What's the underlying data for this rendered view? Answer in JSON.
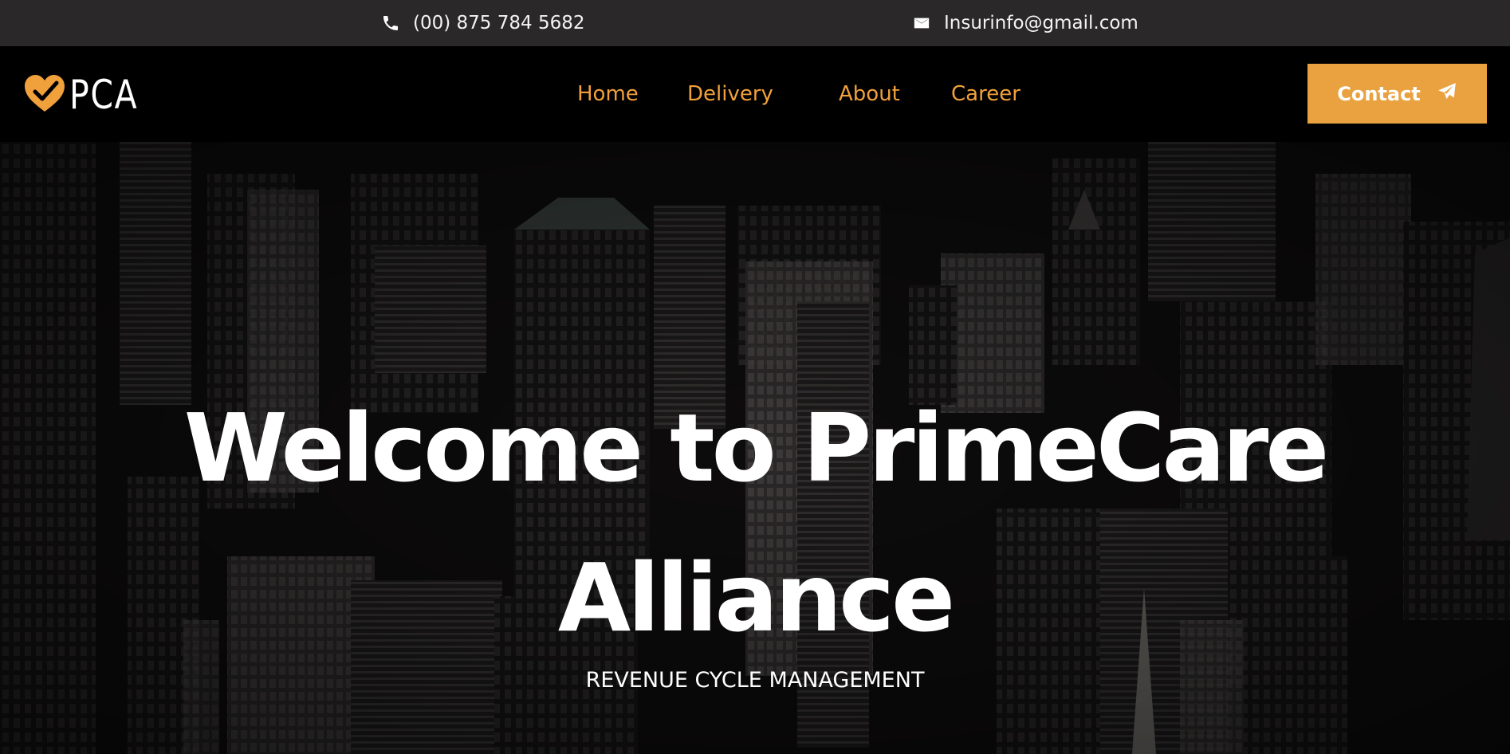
{
  "topbar": {
    "phone": "(00) 875 784 5682",
    "email": "Insurinfo@gmail.com",
    "phone_icon": "phone-icon",
    "email_icon": "mail-icon"
  },
  "navbar": {
    "logo_text": "PCA",
    "logo_icon": "heart-check-icon",
    "links": [
      {
        "label": "Home"
      },
      {
        "label": "Delivery"
      },
      {
        "label": "About"
      },
      {
        "label": "Career"
      }
    ],
    "contact_button": {
      "label": "Contact",
      "icon": "send-icon"
    }
  },
  "hero": {
    "title": "Welcome to PrimeCare Alliance",
    "subtitle": "REVENUE CYCLE MANAGEMENT",
    "background": "city-skyline-image"
  },
  "colors": {
    "accent": "#e9a23f",
    "nav_link": "#f0a13c",
    "topbar_bg": "#2b2829",
    "navbar_bg": "#000000"
  }
}
